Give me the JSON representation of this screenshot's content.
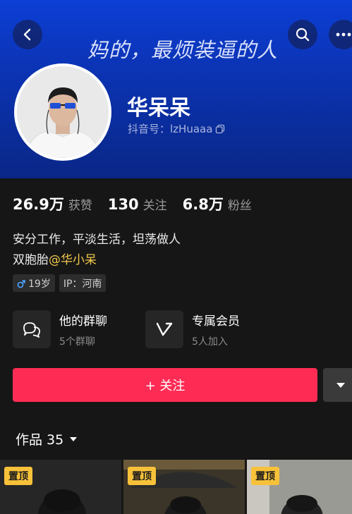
{
  "header": {
    "banner_text": "妈的，最烦装逼的人"
  },
  "profile": {
    "nickname": "华呆呆",
    "douyin_id_label": "抖音号：lzHuaaa"
  },
  "stats": [
    {
      "value": "26.9万",
      "label": "获赞"
    },
    {
      "value": "130",
      "label": "关注"
    },
    {
      "value": "6.8万",
      "label": "粉丝"
    }
  ],
  "bio": {
    "line1": "安分工作，平淡生活，坦荡做人",
    "line2_prefix": "双胞胎",
    "mention": "@华小呆"
  },
  "tags": {
    "age": "19岁",
    "ip": "IP：河南"
  },
  "cards": [
    {
      "title": "他的群聊",
      "subtitle": "5个群聊"
    },
    {
      "title": "专属会员",
      "subtitle": "5人加入"
    }
  ],
  "actions": {
    "follow_label": "+ 关注"
  },
  "tabs": {
    "works_label": "作品 35"
  },
  "thumbnails": [
    {
      "badge": "置顶"
    },
    {
      "badge": "置顶"
    },
    {
      "badge": "置顶"
    }
  ],
  "colors": {
    "accent": "#fe2c55",
    "mention": "#f2c94c",
    "pin": "#f7c23a"
  }
}
